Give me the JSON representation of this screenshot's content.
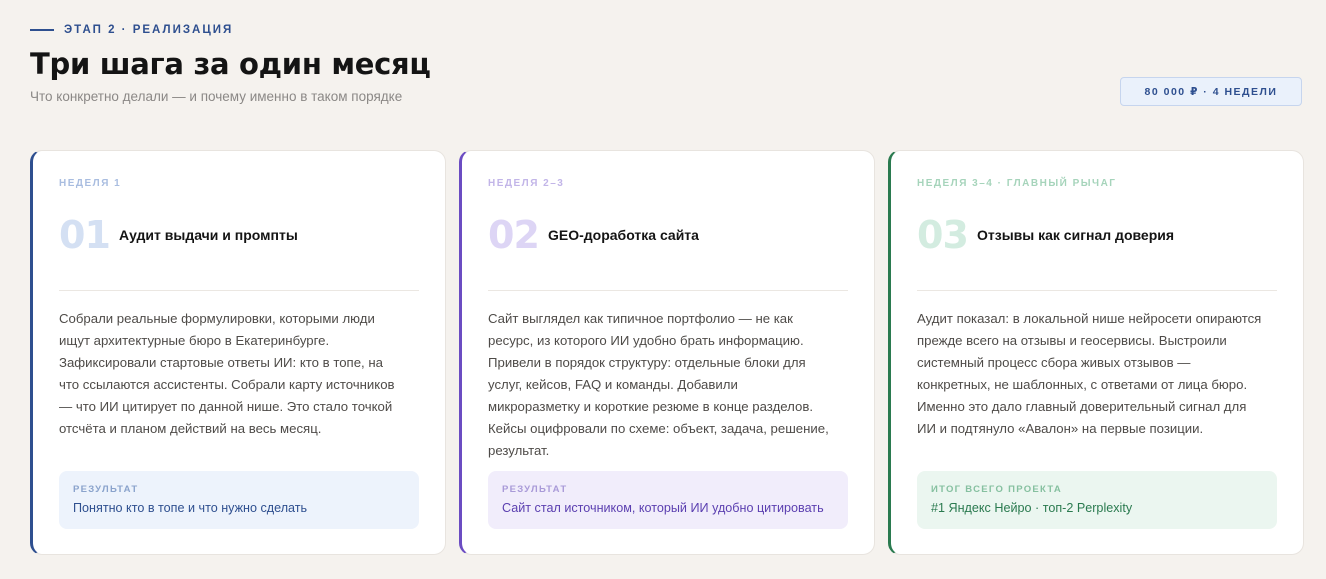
{
  "header": {
    "eyebrow": "ЭТАП 2 · РЕАЛИЗАЦИЯ",
    "title": "Три шага за один месяц",
    "subtitle": "Что конкретно делали — и почему именно в таком порядке",
    "badge": "80 000 ₽ · 4 НЕДЕЛИ"
  },
  "colors": {
    "blue": "#2e4f8f",
    "purple": "#6b4cc2",
    "green": "#2a7a4f",
    "background": "#f5f2ee"
  },
  "cards": [
    {
      "week": "НЕДЕЛЯ 1",
      "number": "01",
      "title": "Аудит выдачи и промпты",
      "lines": [
        "Собрали реальные формулировки, которыми люди",
        "ищут архитектурные бюро в Екатеринбурге.",
        "Зафиксировали стартовые ответы ИИ: кто в топе, на",
        "что ссылаются ассистенты. Собрали карту источников",
        "— что ИИ цитирует по данной нише. Это стало точкой",
        "отсчёта и планом действий на весь месяц."
      ],
      "result_label": "РЕЗУЛЬТАТ",
      "result_text": "Понятно кто в топе и что нужно сделать"
    },
    {
      "week": "НЕДЕЛЯ 2–3",
      "number": "02",
      "title": "GEO-доработка сайта",
      "lines": [
        "Сайт выглядел как типичное портфолио — не как",
        "ресурс, из которого ИИ удобно брать информацию.",
        "Привели в порядок структуру: отдельные блоки для",
        "услуг, кейсов, FAQ и команды. Добавили",
        "микроразметку и короткие резюме в конце разделов.",
        "Кейсы оцифровали по схеме: объект, задача, решение,",
        "результат."
      ],
      "result_label": "РЕЗУЛЬТАТ",
      "result_text": "Сайт стал источником, который ИИ удобно цитировать"
    },
    {
      "week": "НЕДЕЛЯ 3–4 · ГЛАВНЫЙ РЫЧАГ",
      "number": "03",
      "title": "Отзывы как сигнал доверия",
      "lines": [
        "Аудит показал: в локальной нише нейросети опираются",
        "прежде всего на отзывы и геосервисы. Выстроили",
        "системный процесс сбора живых отзывов —",
        "конкретных, не шаблонных, с ответами от лица бюро.",
        "Именно это дало главный доверительный сигнал для",
        "ИИ и подтянуло «Авалон» на первые позиции."
      ],
      "result_label": "ИТОГ ВСЕГО ПРОЕКТА",
      "result_text": "#1 Яндекс Нейро · топ-2 Perplexity"
    }
  ]
}
